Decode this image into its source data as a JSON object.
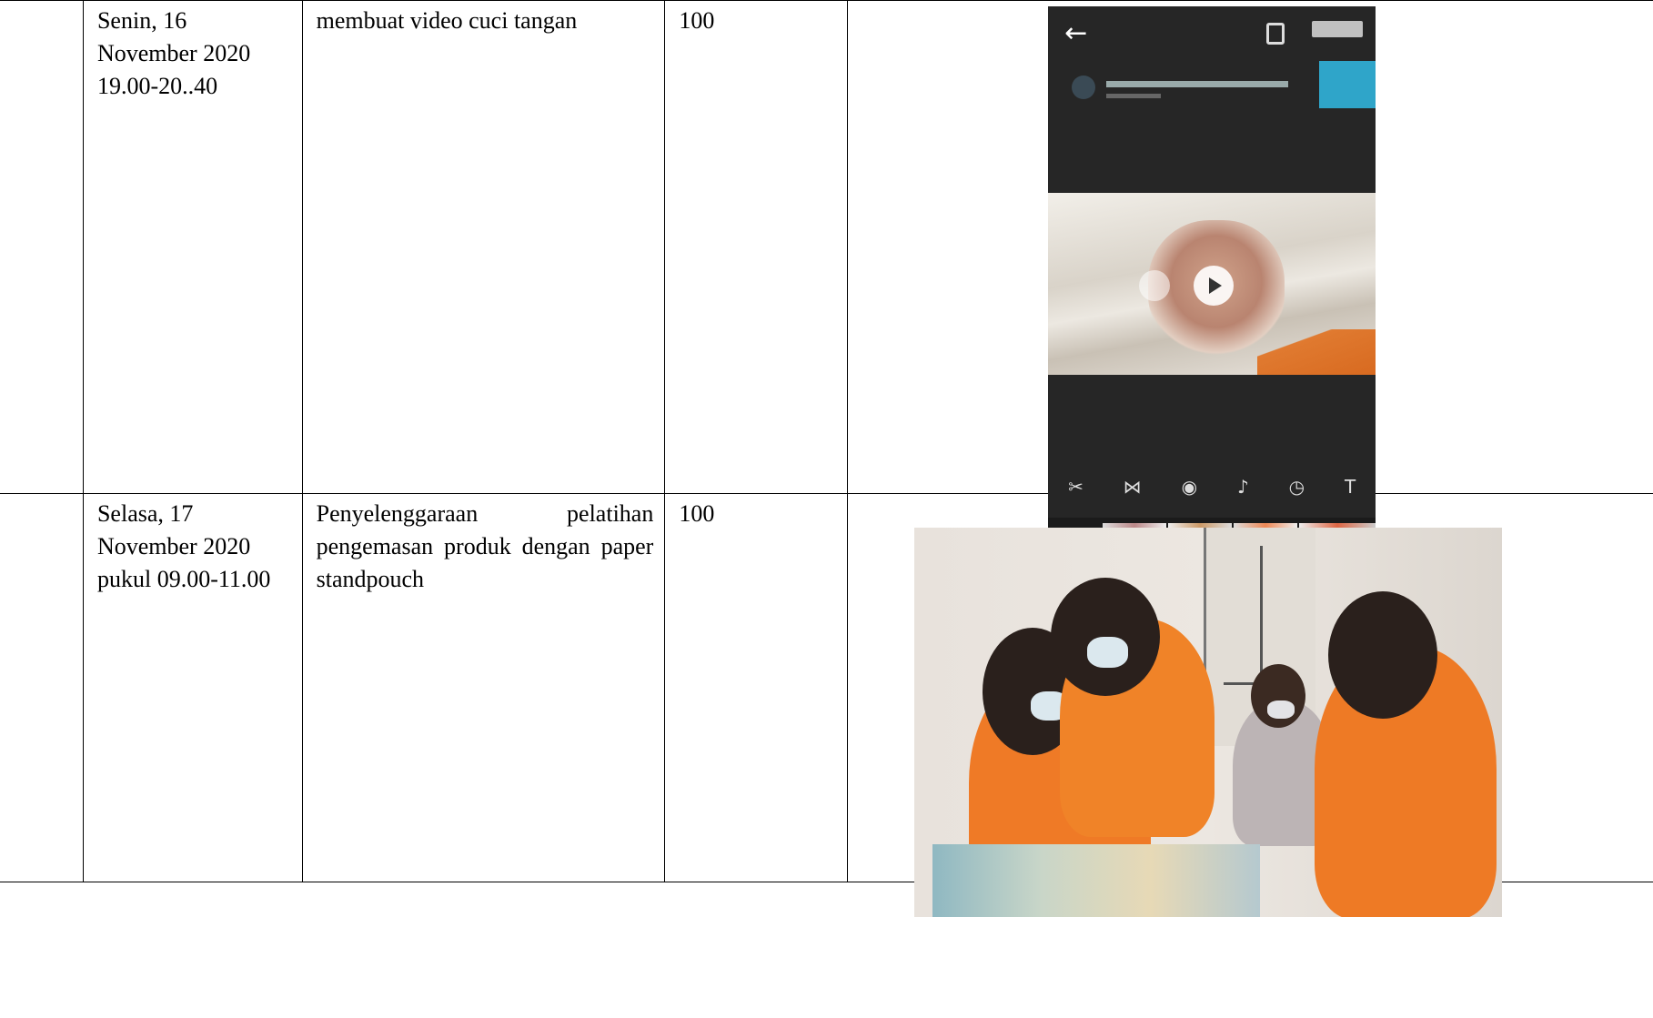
{
  "rows": [
    {
      "no": "",
      "date": "Senin, 16\nNovember 2020\n19.00-20..40",
      "activity": "membuat video cuci tangan",
      "score": "100",
      "documentation": "video-editor-screenshot"
    },
    {
      "no": "",
      "date": "Selasa, 17\nNovember 2020\npukul 09.00-11.00",
      "activity": "Penyelenggaraan pelatihan pengemasan produk dengan paper standpouch",
      "score": "100",
      "documentation": "training-photo"
    }
  ],
  "phone_ui": {
    "back_icon": "arrow-left-icon",
    "clip_icon": "clipboard-icon",
    "play_icon": "play-icon",
    "prev_icon": "skip-back-icon",
    "add_icon": "plus-icon",
    "tool_icons": [
      "cut-icon",
      "split-icon",
      "drop-icon",
      "music-icon",
      "timer-icon",
      "text-icon"
    ],
    "accent_color": "#e5395a",
    "highlight_color": "#2fa5c9"
  },
  "photo_colors": {
    "uniform": "#ef7a26",
    "hijab": "#2a201c"
  }
}
